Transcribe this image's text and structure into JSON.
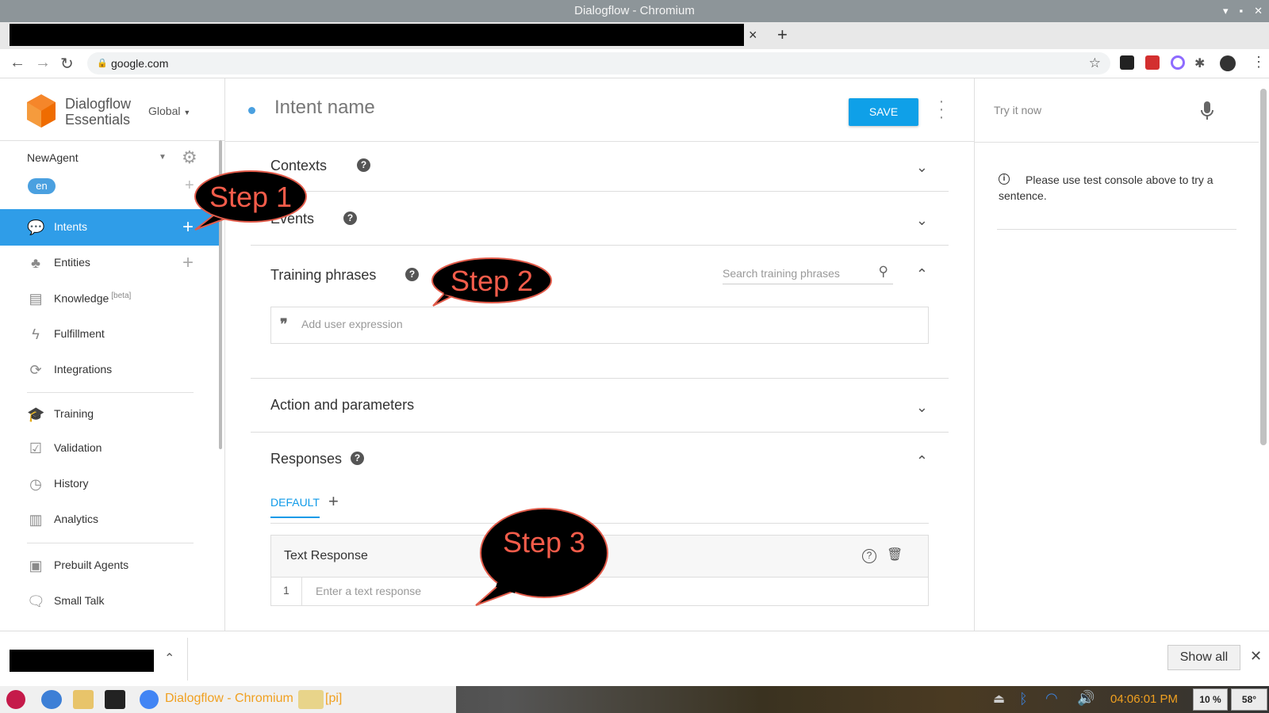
{
  "window": {
    "title": "Dialogflow - Chromium"
  },
  "browser": {
    "url": "google.com",
    "new_tab_glyph": "+",
    "close_tab_glyph": "×"
  },
  "sidebar": {
    "brand_line1": "Dialogflow",
    "brand_line2": "Essentials",
    "region": "Global",
    "agent": "NewAgent",
    "language": "en",
    "items": [
      {
        "label": "Intents",
        "icon": "intents-icon",
        "active": true,
        "plus": true
      },
      {
        "label": "Entities",
        "icon": "entities-icon",
        "plus": true
      },
      {
        "label": "Knowledge",
        "icon": "knowledge-icon",
        "badge": "[beta]"
      },
      {
        "label": "Fulfillment",
        "icon": "fulfillment-icon"
      },
      {
        "label": "Integrations",
        "icon": "integrations-icon"
      },
      {
        "label": "Training",
        "icon": "training-icon"
      },
      {
        "label": "Validation",
        "icon": "validation-icon"
      },
      {
        "label": "History",
        "icon": "history-icon"
      },
      {
        "label": "Analytics",
        "icon": "analytics-icon"
      },
      {
        "label": "Prebuilt Agents",
        "icon": "prebuilt-agents-icon"
      },
      {
        "label": "Small Talk",
        "icon": "small-talk-icon"
      }
    ]
  },
  "header": {
    "intent_placeholder": "Intent name",
    "save_label": "SAVE"
  },
  "sections": {
    "contexts": "Contexts",
    "events": "Events",
    "training": "Training phrases",
    "training_search_placeholder": "Search training phrases",
    "expression_placeholder": "Add user expression",
    "action": "Action and parameters",
    "responses": "Responses",
    "default_tab": "DEFAULT",
    "text_response_title": "Text Response",
    "text_response_num": "1",
    "text_response_placeholder": "Enter a text response"
  },
  "right_panel": {
    "try_placeholder": "Try it now",
    "info": "Please use test console above to try a sentence."
  },
  "callouts": {
    "step1": "Step 1",
    "step2": "Step 2",
    "step3": "Step 3"
  },
  "downloads": {
    "show_all": "Show all"
  },
  "taskbar": {
    "task1": "Dialogflow - Chromium",
    "task2": "[pi]",
    "clock": "04:06:01 PM",
    "cpu": "10 %",
    "temp": "58°"
  },
  "colors": {
    "accent": "#2f9de8",
    "save": "#0fa0e8",
    "callout_text": "#f45c4a"
  }
}
